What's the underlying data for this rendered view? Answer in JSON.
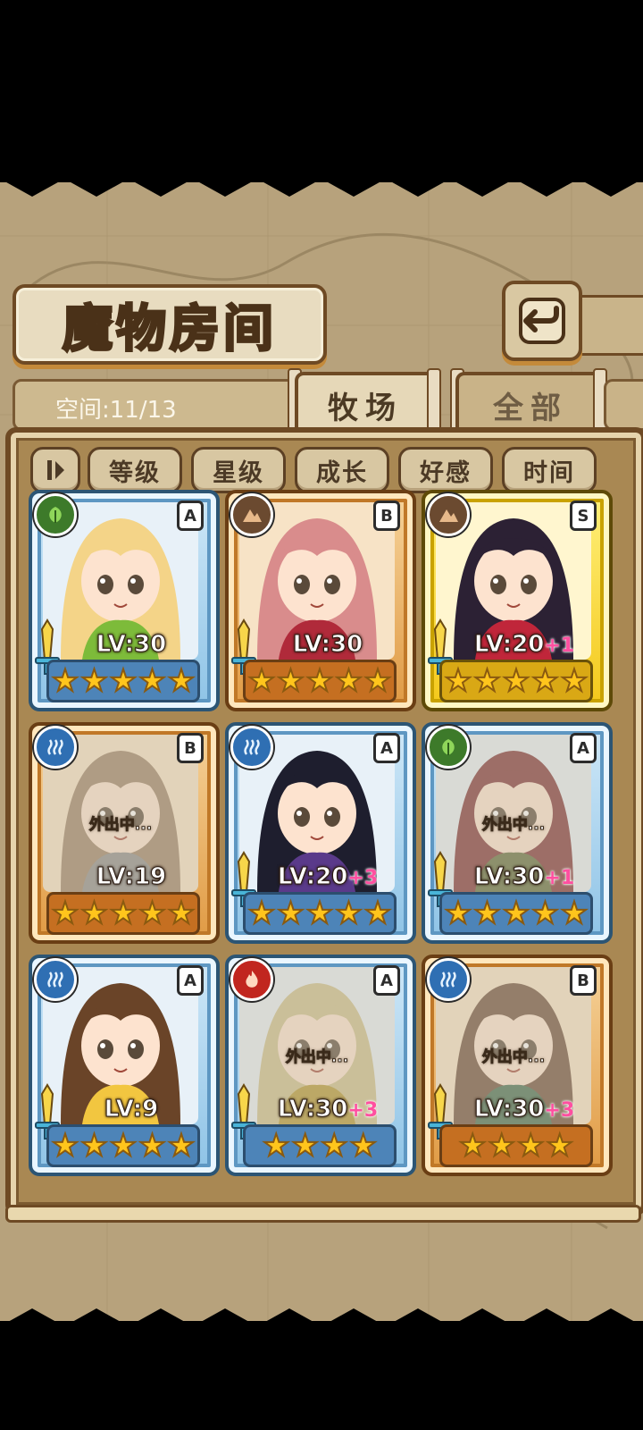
{
  "header": {
    "title": "魔物房间",
    "back_icon": "return-arrow-icon"
  },
  "status": {
    "space_text": "空间:11/13"
  },
  "tabs": [
    {
      "label": "牧场",
      "active": true
    },
    {
      "label": "全部",
      "active": false
    }
  ],
  "sort": {
    "toggle_icon": "sort-toggle-icon",
    "buttons": [
      "等级",
      "星级",
      "成长",
      "好感",
      "时间"
    ]
  },
  "cards": [
    {
      "level": "LV:30",
      "plus": "",
      "grade": "A",
      "element": "leaf",
      "frame": "blue",
      "stars": 5,
      "away": "",
      "hair": "#f4d488",
      "accent": "#7dbb3a"
    },
    {
      "level": "LV:30",
      "plus": "",
      "grade": "B",
      "element": "mountain",
      "frame": "orange",
      "stars": 5,
      "away": "",
      "hair": "#d98c8c",
      "accent": "#b02a3a"
    },
    {
      "level": "LV:20",
      "plus": "+1",
      "grade": "S",
      "element": "mountain",
      "frame": "gold",
      "stars": 5,
      "away": "",
      "hair": "#2c2134",
      "accent": "#c0263a"
    },
    {
      "level": "LV:19",
      "plus": "",
      "grade": "B",
      "element": "water",
      "frame": "orange",
      "stars": 5,
      "away": "外出中...",
      "hair": "#9c8064",
      "accent": "#8a8a8a"
    },
    {
      "level": "LV:20",
      "plus": "+3",
      "grade": "A",
      "element": "water",
      "frame": "blue",
      "stars": 5,
      "away": "",
      "hair": "#1e1e2e",
      "accent": "#5a3a8a"
    },
    {
      "level": "LV:30",
      "plus": "+1",
      "grade": "A",
      "element": "leaf",
      "frame": "blue",
      "stars": 5,
      "away": "外出中...",
      "hair": "#7a2c30",
      "accent": "#5d6a3a"
    },
    {
      "level": "LV:9",
      "plus": "",
      "grade": "A",
      "element": "water",
      "frame": "blue",
      "stars": 5,
      "away": "",
      "hair": "#6a4428",
      "accent": "#f2c640"
    },
    {
      "level": "LV:30",
      "plus": "+3",
      "grade": "A",
      "element": "fire",
      "frame": "blue",
      "stars": 4,
      "away": "外出中...",
      "hair": "#cdbf8a",
      "accent": "#b3962e"
    },
    {
      "level": "LV:30",
      "plus": "+3",
      "grade": "B",
      "element": "water",
      "frame": "orange",
      "stars": 4,
      "away": "外出中...",
      "hair": "#6b4a36",
      "accent": "#3f6a4e"
    }
  ],
  "colors": {
    "parchment": "#b7a27c",
    "wood": "#6e4a24",
    "level_plus": "#ff4fa0",
    "star": "#ffc51c"
  }
}
